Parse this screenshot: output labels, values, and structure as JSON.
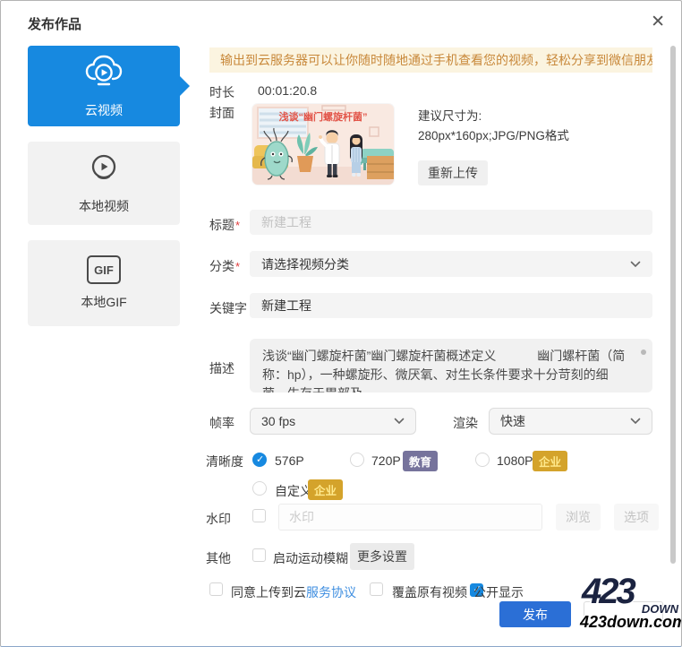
{
  "dialog": {
    "title": "发布作品",
    "close_icon": "✕"
  },
  "sidebar": {
    "items": [
      {
        "label": "云视频",
        "icon": "cloud-play-icon",
        "selected": true
      },
      {
        "label": "本地视频",
        "icon": "play-circle-icon",
        "selected": false
      },
      {
        "label": "本地GIF",
        "icon": "gif-icon",
        "selected": false
      }
    ],
    "gif_icon_text": "GIF"
  },
  "banner": {
    "text": "输出到云服务器可以让你随时随地通过手机查看您的视频，轻松分享到微信朋友圈"
  },
  "form": {
    "duration": {
      "label": "时长",
      "value": "00:01:20.8"
    },
    "cover": {
      "label": "封面",
      "thumbnail_title": "浅谈“幽门螺旋杆菌”",
      "hint_line1": "建议尺寸为:",
      "hint_line2": "280px*160px;JPG/PNG格式",
      "reupload_label": "重新上传"
    },
    "title_field": {
      "label": "标题",
      "required_mark": "*",
      "placeholder": "新建工程",
      "value": ""
    },
    "category": {
      "label": "分类",
      "required_mark": "*",
      "value": "请选择视频分类"
    },
    "keywords": {
      "label": "关键字",
      "value": "新建工程"
    },
    "description": {
      "label": "描述",
      "value": "浅谈“幽门螺旋杆菌”幽门螺旋杆菌概述定义　　　 幽门螺杆菌（简称：hp），一种螺旋形、微厌氧、对生长条件要求十分苛刻的细菌，生存于胃部及"
    },
    "framerate": {
      "label": "帧率",
      "value": "30 fps"
    },
    "render": {
      "label": "渲染",
      "value": "快速"
    },
    "clarity": {
      "label": "清晰度",
      "options": [
        {
          "label": "576P",
          "selected": true,
          "badge": ""
        },
        {
          "label": "720P",
          "selected": false,
          "badge": "教育"
        },
        {
          "label": "1080P",
          "selected": false,
          "badge": "企业"
        },
        {
          "label": "自定义",
          "selected": false,
          "badge": "企业"
        }
      ]
    },
    "watermark": {
      "label": "水印",
      "checked": false,
      "placeholder": "水印",
      "browse_label": "浏览",
      "options_label": "选项"
    },
    "other": {
      "label": "其他",
      "motion_blur_label": "启动运动模糊",
      "checked": false,
      "more_settings_label": "更多设置"
    }
  },
  "footer": {
    "agree": {
      "label": "同意上传到云",
      "link": "服务协议",
      "checked": false
    },
    "overwrite": {
      "label": "覆盖原有视频",
      "checked": false
    },
    "public": {
      "label": "公开显示",
      "checked": true
    },
    "publish_label": "发布"
  },
  "watermark_logo": {
    "big": "423",
    "down": "DOWN",
    "site": "423down.com"
  },
  "colors": {
    "accent_blue": "#1789e0",
    "publish_blue": "#2b6fd6",
    "banner_bg": "#fbf4e0",
    "banner_text": "#c8883a",
    "badge_purple": "#76739c",
    "badge_gold": "#d4a32b",
    "link_blue": "#3e8ee0"
  }
}
